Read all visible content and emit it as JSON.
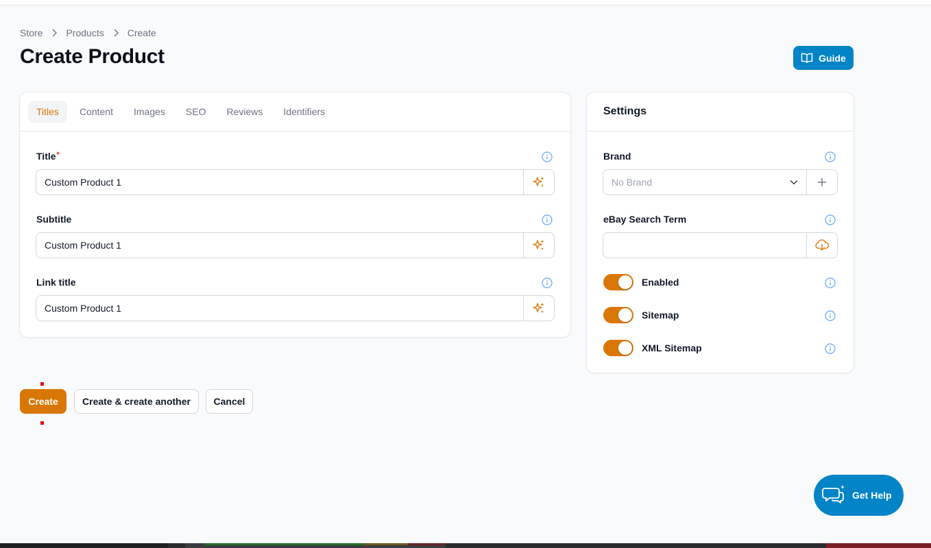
{
  "breadcrumb": [
    "Store",
    "Products",
    "Create"
  ],
  "page_title": "Create Product",
  "guide_button": "Guide",
  "tabs": [
    {
      "label": "Titles",
      "active": true
    },
    {
      "label": "Content",
      "active": false
    },
    {
      "label": "Images",
      "active": false
    },
    {
      "label": "SEO",
      "active": false
    },
    {
      "label": "Reviews",
      "active": false
    },
    {
      "label": "Identifiers",
      "active": false
    }
  ],
  "fields": {
    "title": {
      "label": "Title",
      "required_mark": "*",
      "value": "Custom Product 1"
    },
    "subtitle": {
      "label": "Subtitle",
      "value": "Custom Product 1"
    },
    "link_title": {
      "label": "Link title",
      "value": "Custom Product 1"
    }
  },
  "settings": {
    "title": "Settings",
    "brand": {
      "label": "Brand",
      "placeholder": "No Brand"
    },
    "ebay": {
      "label": "eBay Search Term",
      "value": ""
    },
    "toggles": [
      {
        "label": "Enabled",
        "on": true
      },
      {
        "label": "Sitemap",
        "on": true
      },
      {
        "label": "XML Sitemap",
        "on": true
      }
    ]
  },
  "actions": {
    "create": "Create",
    "create_another": "Create & create another",
    "cancel": "Cancel"
  },
  "help_button": "Get Help",
  "colors": {
    "accent": "#d97706",
    "primary_blue": "#0284c7",
    "info_blue": "#60a5fa"
  },
  "icons": {
    "breadcrumb_separator": "chevron-right-icon",
    "guide": "book-open-icon",
    "ai_generate": "sparkles-icon",
    "info": "info-circle-icon",
    "select_arrow": "chevron-down-icon",
    "add": "plus-icon",
    "ebay_fetch": "cloud-download-icon",
    "help": "chat-bubbles-icon"
  }
}
